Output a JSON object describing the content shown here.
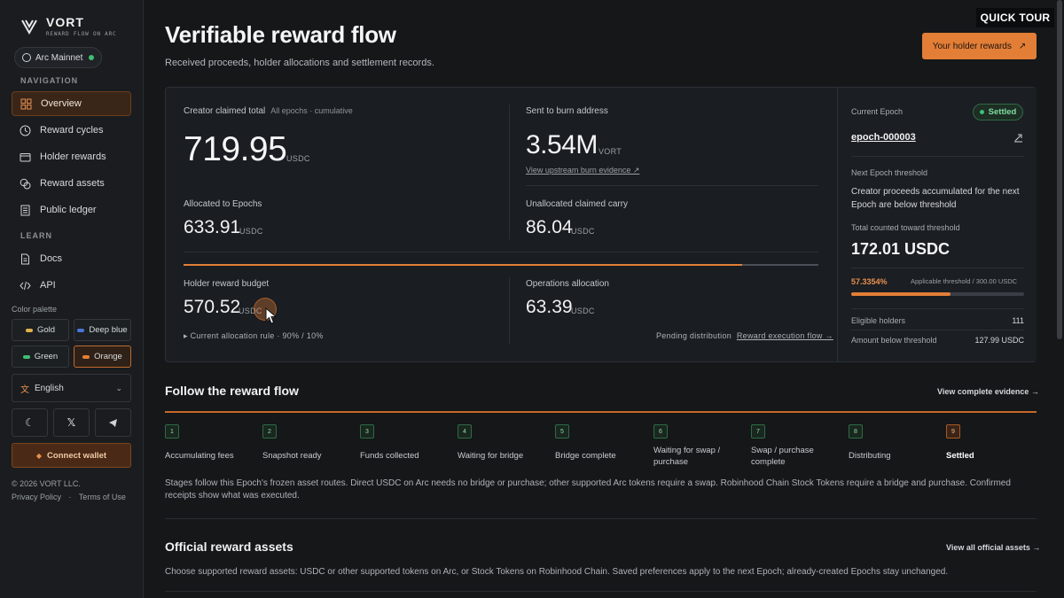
{
  "sidebar": {
    "brand": "VORT",
    "tagline": "REWARD FLOW ON ARC",
    "network": "Arc Mainnet",
    "nav_heading": "NAVIGATION",
    "nav": [
      {
        "label": "Overview",
        "icon": "grid-icon",
        "active": true
      },
      {
        "label": "Reward cycles",
        "icon": "clock-icon"
      },
      {
        "label": "Holder rewards",
        "icon": "wallet-icon"
      },
      {
        "label": "Reward assets",
        "icon": "coins-icon"
      },
      {
        "label": "Public ledger",
        "icon": "ledger-icon"
      }
    ],
    "learn_heading": "LEARN",
    "learn": [
      {
        "label": "Docs",
        "icon": "doc-icon"
      },
      {
        "label": "API",
        "icon": "code-icon"
      }
    ],
    "palette_label": "Color palette",
    "palette": [
      {
        "label": "Gold",
        "color": "#e0b04a"
      },
      {
        "label": "Deep blue",
        "color": "#4a76d9"
      },
      {
        "label": "Green",
        "color": "#3fbf73"
      },
      {
        "label": "Orange",
        "color": "#e37e37",
        "selected": true
      }
    ],
    "language": "English",
    "social": [
      "moon-icon",
      "x-icon",
      "telegram-icon"
    ],
    "connect": "Connect wallet",
    "copyright": "© 2026 VORT LLC.",
    "privacy": "Privacy Policy",
    "terms": "Terms of Use"
  },
  "header": {
    "title": "Verifiable reward flow",
    "subtitle": "Received proceeds, holder allocations and settlement records.",
    "quick_tour": "QUICK TOUR",
    "holder_button": "Your holder rewards"
  },
  "stats": {
    "claimed_label": "Creator claimed total",
    "claimed_note": "All epochs · cumulative",
    "claimed_value": "719.95",
    "claimed_unit": "USDC",
    "burn_label": "Sent to burn address",
    "burn_value": "3.54M",
    "burn_unit": "VORT",
    "burn_link": "View upstream burn evidence ↗",
    "allocated_label": "Allocated to Epochs",
    "allocated_value": "633.91",
    "allocated_unit": "USDC",
    "unallocated_label": "Unallocated claimed carry",
    "unallocated_value": "86.04",
    "unallocated_unit": "USDC",
    "allocation_split": 0.88,
    "holder_label": "Holder reward budget",
    "holder_value": "570.52",
    "holder_unit": "USDC",
    "ops_label": "Operations allocation",
    "ops_value": "63.39",
    "ops_unit": "USDC",
    "rule": "▸ Current allocation rule · 90% / 10%",
    "pending_label": "Pending distribution",
    "pending_link": "Reward execution flow →"
  },
  "epoch": {
    "label": "Current Epoch",
    "status": "Settled",
    "id": "epoch-000003",
    "next_label": "Next Epoch threshold",
    "next_text": "Creator proceeds accumulated for the next Epoch are below threshold",
    "counted_label": "Total counted toward threshold",
    "counted_value": "172.01 USDC",
    "percent": "57.3354%",
    "progress": 0.573354,
    "threshold_text": "Applicable threshold / 300.00 USDC",
    "eligible_label": "Eligible holders",
    "eligible_value": "111",
    "below_label": "Amount below threshold",
    "below_value": "127.99 USDC"
  },
  "flow": {
    "title": "Follow the reward flow",
    "link": "View complete evidence →",
    "steps": [
      {
        "n": "1",
        "label": "Accumulating fees"
      },
      {
        "n": "2",
        "label": "Snapshot ready"
      },
      {
        "n": "3",
        "label": "Funds collected"
      },
      {
        "n": "4",
        "label": "Waiting for bridge"
      },
      {
        "n": "5",
        "label": "Bridge complete"
      },
      {
        "n": "6",
        "label": "Waiting for swap / purchase"
      },
      {
        "n": "7",
        "label": "Swap / purchase complete"
      },
      {
        "n": "8",
        "label": "Distributing"
      },
      {
        "n": "9",
        "label": "Settled",
        "current": true
      }
    ],
    "note": "Stages follow this Epoch's frozen asset routes. Direct USDC on Arc needs no bridge or purchase; other supported Arc tokens require a swap. Robinhood Chain Stock Tokens require a bridge and purchase. Confirmed receipts show what was executed."
  },
  "assets": {
    "title": "Official reward assets",
    "link": "View all official assets →",
    "note": "Choose supported reward assets: USDC or other supported tokens on Arc, or Stock Tokens on Robinhood Chain. Saved preferences apply to the next Epoch; already-created Epochs stay unchanged."
  },
  "colors": {
    "accent": "#e37e37",
    "success": "#3fbf73"
  }
}
